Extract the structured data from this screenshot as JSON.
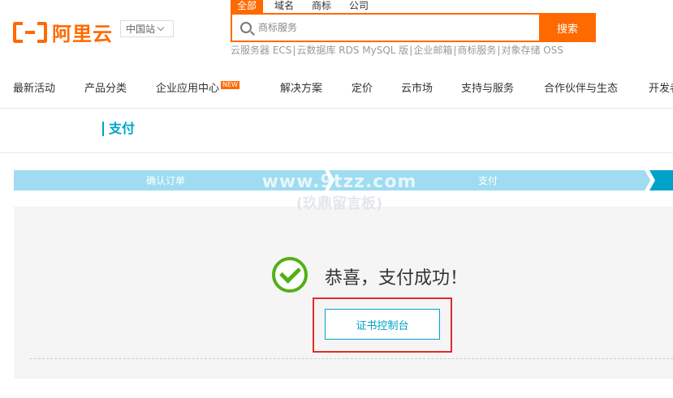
{
  "header": {
    "logo_text": "阿里云",
    "site_select": "中国站",
    "search_tabs": [
      "全部",
      "域名",
      "商标",
      "公司"
    ],
    "search_placeholder": "商标服务",
    "search_button": "搜索",
    "hot_links": [
      "云服务器 ECS",
      "云数据库 RDS MySQL 版",
      "企业邮箱",
      "商标服务",
      "对象存储 OSS"
    ]
  },
  "nav": {
    "items": [
      "最新活动",
      "产品分类",
      "企业应用中心",
      "解决方案",
      "定价",
      "云市场",
      "支持与服务",
      "合作伙伴与生态",
      "开发者"
    ],
    "new_badge": "NEW"
  },
  "page": {
    "title": "支付"
  },
  "steps": {
    "items": [
      "确认订单",
      "支付"
    ]
  },
  "result": {
    "message": "恭喜，支付成功！",
    "console_button": "证书控制台"
  },
  "watermark": {
    "line1": "www.9tzz.com",
    "line2": "(玖鼎留言板)"
  },
  "colors": {
    "brand_orange": "#ff6a00",
    "accent_blue": "#00a2ca",
    "step_light": "#9fdcf2",
    "success_green": "#53b016",
    "highlight_red": "#e02b2b"
  }
}
